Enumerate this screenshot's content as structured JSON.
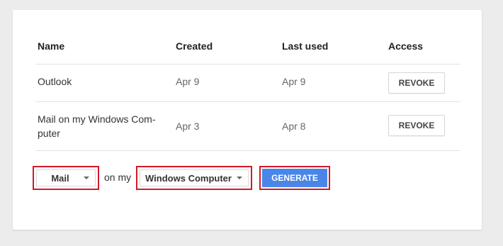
{
  "table": {
    "headers": {
      "name": "Name",
      "created": "Created",
      "last_used": "Last used",
      "access": "Access"
    },
    "rows": [
      {
        "name": "Outlook",
        "created": "Apr 9",
        "last_used": "Apr 9",
        "action": "REVOKE"
      },
      {
        "name": "Mail on my Windows Com-\nputer",
        "created": "Apr 3",
        "last_used": "Apr 8",
        "action": "REVOKE"
      }
    ]
  },
  "generator": {
    "app_select": "Mail",
    "connector_text": "on my",
    "device_select": "Windows Computer",
    "generate_label": "GENERATE"
  },
  "colors": {
    "highlight": "#d3182a",
    "primary_button": "#4a86e8",
    "card_bg": "#ffffff",
    "page_bg": "#ececec"
  }
}
